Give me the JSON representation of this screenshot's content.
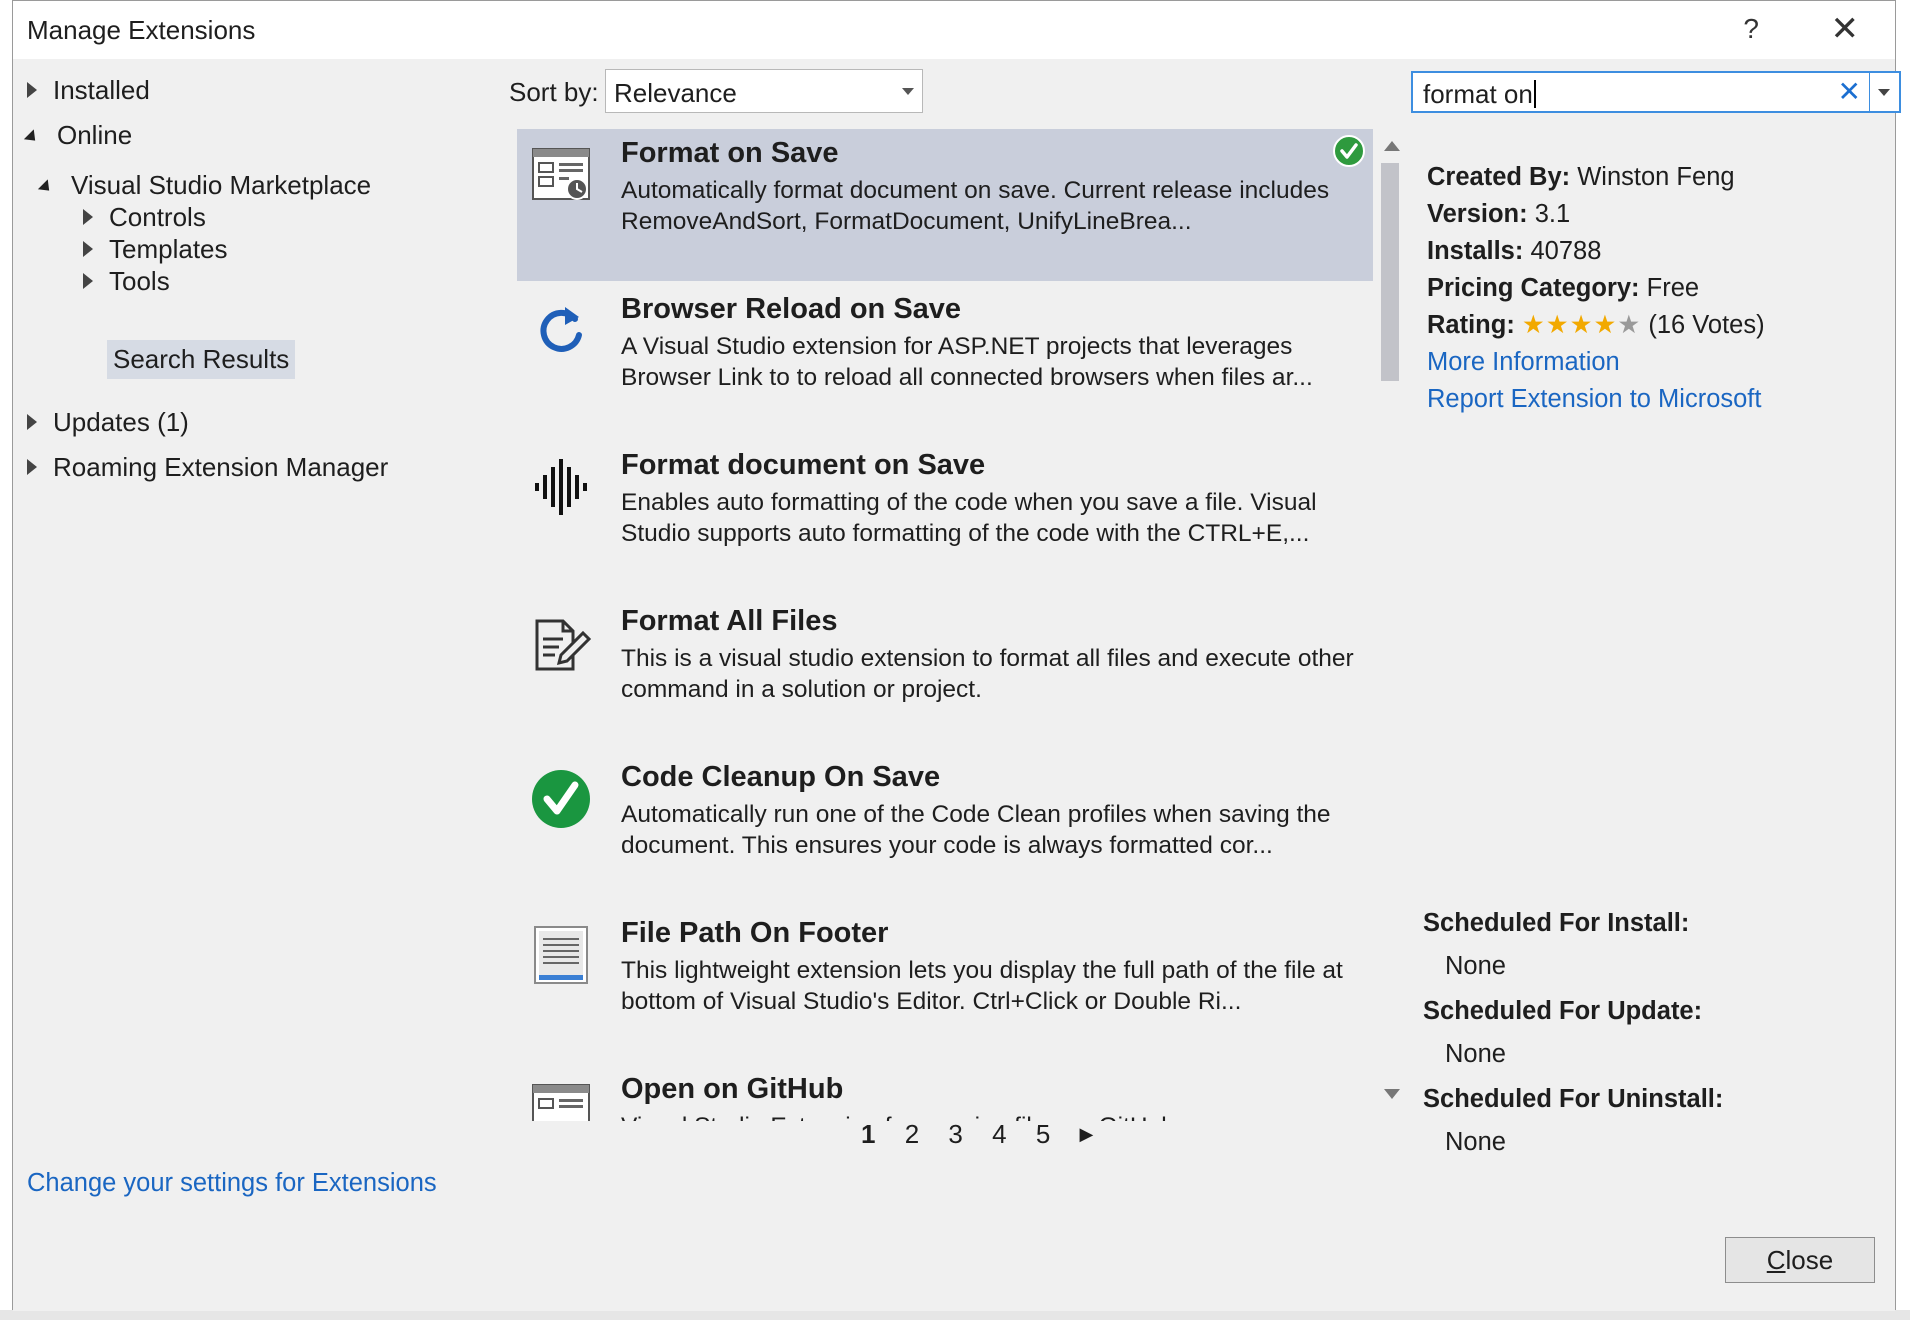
{
  "window": {
    "title": "Manage Extensions",
    "help": "?",
    "close": "✕"
  },
  "nav": {
    "installed": "Installed",
    "online": "Online",
    "marketplace": "Visual Studio Marketplace",
    "controls": "Controls",
    "templates": "Templates",
    "tools": "Tools",
    "search_results": "Search Results",
    "updates": "Updates (1)",
    "roaming": "Roaming Extension Manager"
  },
  "sort": {
    "label": "Sort by:",
    "value": "Relevance"
  },
  "search": {
    "value": "format on",
    "clear": "✕"
  },
  "extensions": [
    {
      "title": "Format on Save",
      "desc": "Automatically format document on save. Current release includes RemoveAndSort, FormatDocument, UnifyLineBrea...",
      "icon": "extension-window-icon",
      "installed": true
    },
    {
      "title": "Browser Reload on Save",
      "desc": "A Visual Studio extension for ASP.NET projects that leverages Browser Link to to reload all connected browsers when files ar...",
      "icon": "refresh-icon"
    },
    {
      "title": "Format document on Save",
      "desc": "Enables auto formatting of the code when you save a file. Visual Studio supports auto formatting of the code with the CTRL+E,...",
      "icon": "audio-wave-icon"
    },
    {
      "title": "Format All Files",
      "desc": "This is a visual studio extension to format all files and execute other command in a solution or project.",
      "icon": "document-edit-icon"
    },
    {
      "title": "Code Cleanup On Save",
      "desc": "Automatically run one of the Code Clean profiles when saving the document. This ensures your code is always formatted cor...",
      "icon": "green-check-icon"
    },
    {
      "title": "File Path On Footer",
      "desc": "This lightweight extension lets you display the full path of the file at bottom of Visual Studio's Editor. Ctrl+Click or Double Ri...",
      "icon": "text-file-icon"
    },
    {
      "title": "Open on GitHub",
      "desc": "Visual Studio Extension for opening files on GitHub",
      "icon": "extension-window-icon"
    }
  ],
  "pager": {
    "pages": [
      "1",
      "2",
      "3",
      "4",
      "5"
    ],
    "current": "1",
    "next": "▶"
  },
  "details": {
    "created_by_label": "Created By:",
    "created_by": "Winston Feng",
    "version_label": "Version:",
    "version": "3.1",
    "installs_label": "Installs:",
    "installs": "40788",
    "pricing_label": "Pricing Category:",
    "pricing": "Free",
    "rating_label": "Rating:",
    "rating_value": 4,
    "rating_max": 5,
    "rating_stars_filled": "★★★★",
    "rating_stars_empty": "★",
    "votes": "(16 Votes)",
    "more_info": "More Information",
    "report": "Report Extension to Microsoft"
  },
  "scheduled": {
    "install_label": "Scheduled For Install:",
    "install": "None",
    "update_label": "Scheduled For Update:",
    "update": "None",
    "uninstall_label": "Scheduled For Uninstall:",
    "uninstall": "None"
  },
  "footer": {
    "settings_link": "Change your settings for Extensions",
    "close_mnemonic": "C",
    "close_rest": "lose"
  },
  "colors": {
    "accent": "#1a66c2",
    "selected": "#c9cedb",
    "star": "#f2a900",
    "installed": "#2e9a3e"
  }
}
